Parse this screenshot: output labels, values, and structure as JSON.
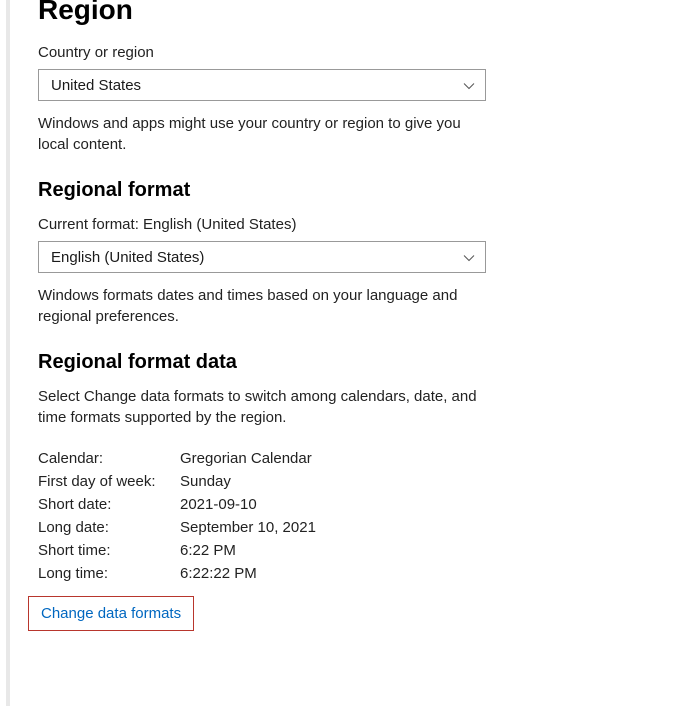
{
  "page": {
    "title": "Region"
  },
  "country": {
    "label": "Country or region",
    "selected": "United States",
    "helper": "Windows and apps might use your country or region to give you local content."
  },
  "regional_format": {
    "heading": "Regional format",
    "current_label": "Current format: English (United States)",
    "selected": "English (United States)",
    "helper": "Windows formats dates and times based on your language and regional preferences."
  },
  "regional_format_data": {
    "heading": "Regional format data",
    "helper": "Select Change data formats to switch among calendars, date, and time formats supported by the region.",
    "rows": {
      "calendar_label": "Calendar:",
      "calendar_value": "Gregorian Calendar",
      "first_day_label": "First day of week:",
      "first_day_value": "Sunday",
      "short_date_label": "Short date:",
      "short_date_value": "2021-09-10",
      "long_date_label": "Long date:",
      "long_date_value": "September 10, 2021",
      "short_time_label": "Short time:",
      "short_time_value": "6:22 PM",
      "long_time_label": "Long time:",
      "long_time_value": "6:22:22 PM"
    },
    "change_link": "Change data formats"
  }
}
